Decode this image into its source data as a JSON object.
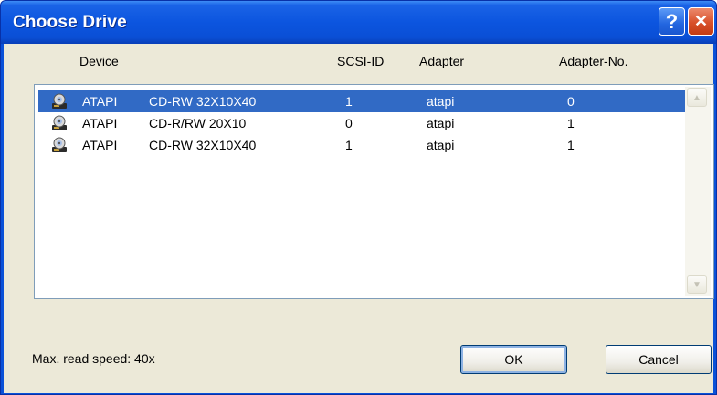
{
  "window": {
    "title": "Choose Drive",
    "help_label": "?",
    "close_label": "✕"
  },
  "columns": [
    "Device",
    "SCSI-ID",
    "Adapter",
    "Adapter-No."
  ],
  "drives": [
    {
      "vendor": "ATAPI",
      "model": "CD-RW 32X10X40",
      "scsi_id": "1",
      "adapter": "atapi",
      "adapter_no": "0",
      "selected": true
    },
    {
      "vendor": "ATAPI",
      "model": "CD-R/RW 20X10",
      "scsi_id": "0",
      "adapter": "atapi",
      "adapter_no": "1",
      "selected": false
    },
    {
      "vendor": "ATAPI",
      "model": "CD-RW 32X10X40",
      "scsi_id": "1",
      "adapter": "atapi",
      "adapter_no": "1",
      "selected": false
    }
  ],
  "status": {
    "read_speed": "Max. read speed: 40x"
  },
  "buttons": {
    "ok": "OK",
    "cancel": "Cancel"
  },
  "icons": {
    "scroll_up": "▲",
    "scroll_down": "▼",
    "drive": "cd-drive-icon"
  },
  "colors": {
    "selection": "#316ac5",
    "titlebar": "#0a4fd6"
  }
}
